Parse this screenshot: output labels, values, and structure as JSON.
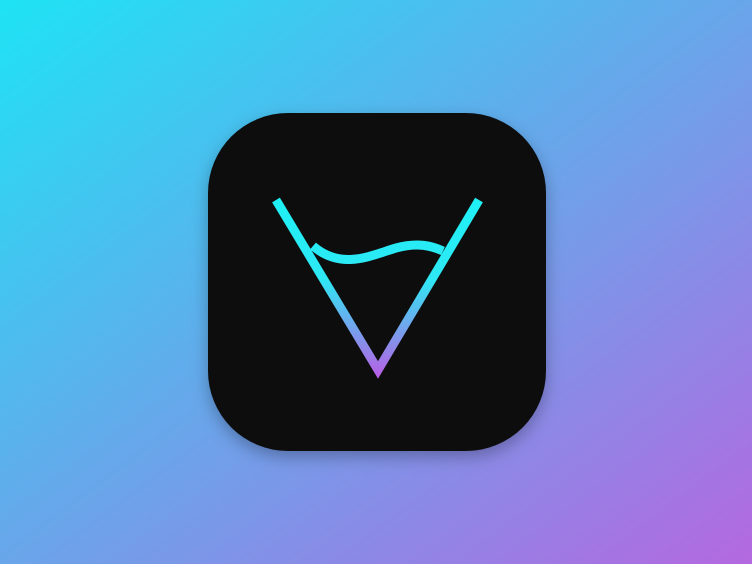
{
  "background": {
    "gradient_start_color": "#1ee3f5",
    "gradient_end_color": "#b468e0"
  },
  "app_icon": {
    "name": "app-icon",
    "tile_color": "#0a0d0e",
    "mark_colors": {
      "top": "#1ff0f6",
      "bottom": "#b760e6"
    }
  }
}
